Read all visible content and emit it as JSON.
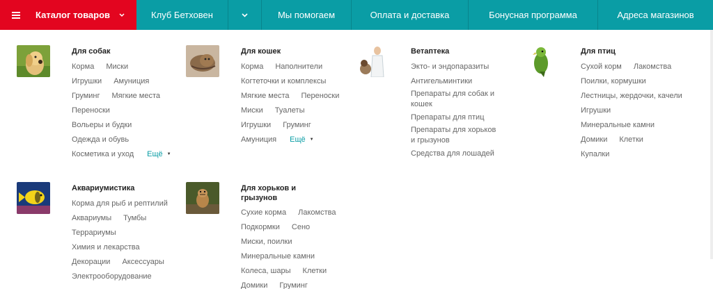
{
  "topnav": {
    "catalog_label": "Каталог товаров",
    "items": [
      "Клуб Бетховен",
      "Мы помогаем",
      "Оплата и доставка",
      "Бонусная программа",
      "Адреса магазинов"
    ]
  },
  "colors": {
    "brand_red": "#e3051f",
    "nav_teal": "#0a9da5",
    "link_accent": "#0a9da5"
  },
  "menu": {
    "dogs": {
      "title": "Для собак",
      "rows": [
        [
          "Корма",
          "Миски"
        ],
        [
          "Игрушки",
          "Амуниция"
        ],
        [
          "Груминг",
          "Мягкие места"
        ],
        [
          "Переноски"
        ],
        [
          "Вольеры и будки"
        ],
        [
          "Одежда и обувь"
        ],
        [
          "Косметика и уход"
        ]
      ],
      "more": "Ещё"
    },
    "cats": {
      "title": "Для кошек",
      "rows": [
        [
          "Корма",
          "Наполнители"
        ],
        [
          "Когтеточки и комплексы"
        ],
        [
          "Мягкие места",
          "Переноски"
        ],
        [
          "Миски",
          "Туалеты"
        ],
        [
          "Игрушки",
          "Груминг"
        ],
        [
          "Амуниция"
        ]
      ],
      "more": "Ещё"
    },
    "vet": {
      "title": "Ветаптека",
      "rows": [
        "Экто- и эндопаразиты",
        "Антигельминтики",
        "Препараты для собак и кошек",
        "Препараты для птиц",
        "Препараты для хорьков и грызунов",
        "Средства для лошадей"
      ]
    },
    "birds": {
      "title": "Для птиц",
      "rows": [
        [
          "Сухой корм",
          "Лакомства"
        ],
        [
          "Поилки, кормушки"
        ],
        [
          "Лестницы, жердочки, качели"
        ],
        [
          "Игрушки"
        ],
        [
          "Минеральные камни"
        ],
        [
          "Домики",
          "Клетки"
        ],
        [
          "Купалки"
        ]
      ]
    },
    "aqua": {
      "title": "Аквариумистика",
      "rows": [
        [
          "Корма для рыб и рептилий"
        ],
        [
          "Аквариумы",
          "Тумбы"
        ],
        [
          "Террариумы"
        ],
        [
          "Химия и лекарства"
        ],
        [
          "Декорации",
          "Аксессуары"
        ],
        [
          "Электрооборудование"
        ]
      ]
    },
    "rodents": {
      "title": "Для хорьков и грызунов",
      "rows": [
        [
          "Сухие корма",
          "Лакомства"
        ],
        [
          "Подкормки",
          "Сено"
        ],
        [
          "Миски, поилки"
        ],
        [
          "Минеральные камни"
        ],
        [
          "Колеса, шары",
          "Клетки"
        ],
        [
          "Домики",
          "Груминг"
        ]
      ]
    }
  }
}
